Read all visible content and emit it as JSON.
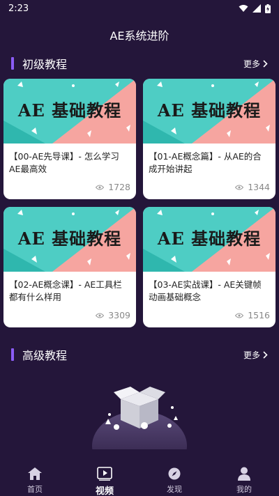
{
  "status_bar": {
    "time": "2:23"
  },
  "app_title": "AE系统进阶",
  "sections": {
    "basic": {
      "title": "初级教程",
      "more": "更多"
    },
    "advanced": {
      "title": "高级教程",
      "more": "更多"
    }
  },
  "thumbnail_text": "AE 基础教程",
  "cards": [
    {
      "title": "【00-AE先导课】- 怎么学习AE最高效",
      "views": "1728"
    },
    {
      "title": "【01-AE概念篇】- 从AE的合成开始讲起",
      "views": "1344"
    },
    {
      "title": "【02-AE概念课】- AE工具栏都有什么样用",
      "views": "3309"
    },
    {
      "title": "【03-AE实战课】- AE关键帧动画基础概念",
      "views": "1516"
    }
  ],
  "bottom_nav": [
    {
      "label": "首页",
      "icon": "home-icon"
    },
    {
      "label": "视频",
      "icon": "video-icon",
      "active": true
    },
    {
      "label": "发现",
      "icon": "compass-icon"
    },
    {
      "label": "我的",
      "icon": "user-icon"
    }
  ],
  "colors": {
    "background": "#24163a",
    "accent": "#8b5cf6",
    "teal": "#4ecdc4",
    "pink": "#f6a5a0"
  }
}
